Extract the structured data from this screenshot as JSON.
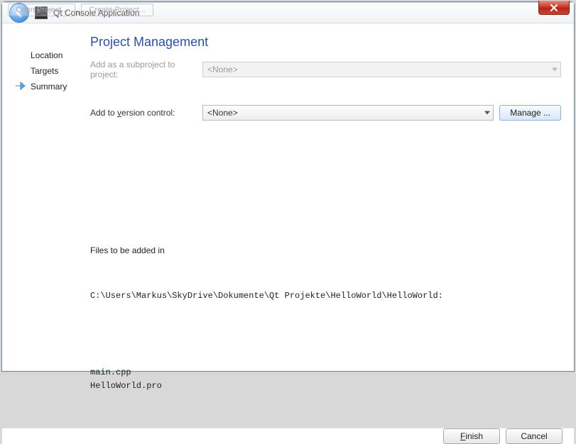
{
  "window": {
    "tabs": [
      "Open Project...",
      "Create Project..."
    ]
  },
  "header": {
    "title": "Qt Console Application"
  },
  "sidebar": {
    "items": [
      {
        "label": "Location"
      },
      {
        "label": "Targets"
      },
      {
        "label": "Summary",
        "current": true
      }
    ]
  },
  "page": {
    "title": "Project Management",
    "subproject_label": "Add as a subproject to project:",
    "subproject_value": "<None>",
    "vcs_label_pre": "Add to ",
    "vcs_label_key": "v",
    "vcs_label_post": "ersion control:",
    "vcs_value": "<None>",
    "manage_label": "Manage ..."
  },
  "files": {
    "heading": "Files to be added in",
    "path": "C:\\Users\\Markus\\SkyDrive\\Dokumente\\Qt Projekte\\HelloWorld\\HelloWorld:",
    "list": "main.cpp\nHelloWorld.pro"
  },
  "footer": {
    "finish_pre": "",
    "finish_key": "F",
    "finish_post": "inish",
    "cancel": "Cancel"
  }
}
